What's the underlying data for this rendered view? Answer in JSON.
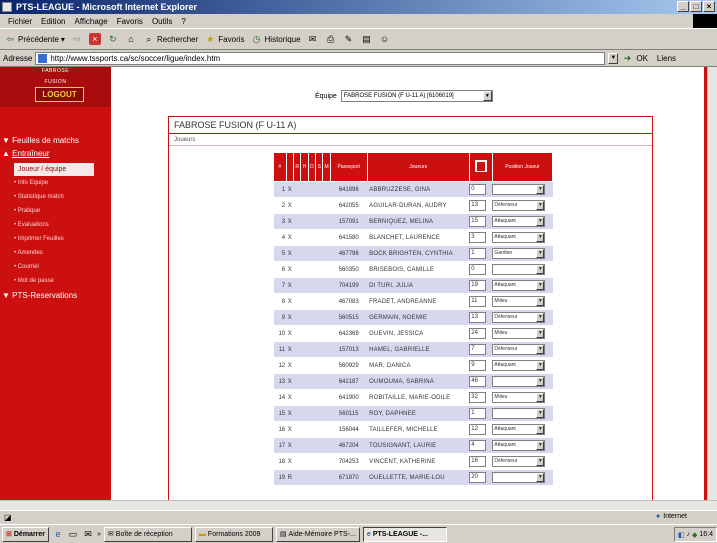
{
  "window": {
    "title": "PTS-LEAGUE - Microsoft Internet Explorer",
    "controls": [
      "_",
      "□",
      "×"
    ]
  },
  "menu": [
    "Fichier",
    "Edition",
    "Affichage",
    "Favoris",
    "Outils",
    "?"
  ],
  "toolbar": {
    "back_label": "Précédente",
    "search_label": "Rechercher",
    "favorites_label": "Favoris",
    "history_label": "Historique"
  },
  "address": {
    "label": "Adresse",
    "url": "http://www.tssports.ca/sc/soccer/ligue/index.htm",
    "go_label": "OK",
    "links_label": "Liens"
  },
  "sidebar": {
    "org_line1": "FABROSE",
    "org_line2": "FUSION",
    "logout_label": "LOGOUT",
    "feuilles": "Feuilles de matchs",
    "entraineur": "Entraîneur",
    "active_item": "Joueur / équipe",
    "sub_items": [
      "Info Equipe",
      "Statistique match",
      "Pratique",
      "Evaluations",
      "Imprimer Feuilles",
      "Amendes",
      "Courriel",
      "Mot de passe"
    ],
    "reservations": "PTS-Reservations"
  },
  "main": {
    "equipe_label": "Équipe",
    "equipe_value": "FABROSE FUSION (F U-11 A) [6106019]",
    "panel_title": "FABROSE FUSION (F U-11 A)",
    "panel_sub": "Joueurs"
  },
  "roster": {
    "headers": {
      "num": "#",
      "r": "R",
      "h": "H",
      "d": "D",
      "s": "S",
      "m": "M",
      "passport": "Passeport",
      "players": "Joueurs",
      "position": "Position Joueur"
    },
    "rows": [
      {
        "num": "1",
        "x": "X",
        "passport": "641898",
        "name": "ABBRUZZESE, GINA",
        "jersey": "0",
        "position": ""
      },
      {
        "num": "2",
        "x": "X",
        "passport": "642055",
        "name": "AGUILAR-DURAN, AUDRY",
        "jersey": "13",
        "position": "Défenseur"
      },
      {
        "num": "3",
        "x": "X",
        "passport": "157091",
        "name": "BERNIQUEZ, MELINA",
        "jersey": "15",
        "position": "Attaquant"
      },
      {
        "num": "4",
        "x": "X",
        "passport": "641580",
        "name": "BLANCHET, LAURENCE",
        "jersey": "3",
        "position": "Attaquant"
      },
      {
        "num": "5",
        "x": "X",
        "passport": "467798",
        "name": "BOCK BRIGHTEN, CYNTHIA",
        "jersey": "1",
        "position": "Gardien"
      },
      {
        "num": "6",
        "x": "X",
        "passport": "560350",
        "name": "BRISEBOIS, CAMILLE",
        "jersey": "0",
        "position": ""
      },
      {
        "num": "7",
        "x": "X",
        "passport": "704199",
        "name": "DI TURI, JULIA",
        "jersey": "19",
        "position": "Attaquant"
      },
      {
        "num": "8",
        "x": "X",
        "passport": "467083",
        "name": "FRADET, ANDREANNE",
        "jersey": "11",
        "position": "Milieu"
      },
      {
        "num": "9",
        "x": "X",
        "passport": "560515",
        "name": "GERMAIN, NOEMIE",
        "jersey": "13",
        "position": "Défenseur"
      },
      {
        "num": "10",
        "x": "X",
        "passport": "642369",
        "name": "GUEVIN, JESSICA",
        "jersey": "24",
        "position": "Milieu"
      },
      {
        "num": "11",
        "x": "X",
        "passport": "157013",
        "name": "HAMEL, GABRIELLE",
        "jersey": "7",
        "position": "Défenseur"
      },
      {
        "num": "12",
        "x": "X",
        "passport": "560929",
        "name": "MAR, DANICA",
        "jersey": "9",
        "position": "Attaquant"
      },
      {
        "num": "13",
        "x": "X",
        "passport": "642187",
        "name": "OUMOUMA, SABRINA",
        "jersey": "46",
        "position": ""
      },
      {
        "num": "14",
        "x": "X",
        "passport": "641900",
        "name": "ROBITAILLE, MARIE-ODILE",
        "jersey": "32",
        "position": "Milieu"
      },
      {
        "num": "15",
        "x": "X",
        "passport": "560115",
        "name": "ROY, DAPHNEE",
        "jersey": "1",
        "position": ""
      },
      {
        "num": "16",
        "x": "X",
        "passport": "156044",
        "name": "TAILLEFER, MICHELLE",
        "jersey": "12",
        "position": "Attaquant"
      },
      {
        "num": "17",
        "x": "X",
        "passport": "467204",
        "name": "TOUSIGNANT, LAURIE",
        "jersey": "4",
        "position": "Attaquant"
      },
      {
        "num": "18",
        "x": "X",
        "passport": "704253",
        "name": "VINCENT, KATHERINE",
        "jersey": "16",
        "position": "Défenseur"
      },
      {
        "num": "19",
        "x": "R",
        "passport": "671870",
        "name": "OUELLETTE, MARIE-LOU",
        "jersey": "20",
        "position": ""
      }
    ]
  },
  "status": {
    "zone_label": "Internet"
  },
  "taskbar": {
    "start_label": "Démarrer",
    "items": [
      "Boîte de réception",
      "Formations 2009",
      "Aide-Mémoire PTS-...",
      "PTS-LEAGUE -..."
    ],
    "clock": "16:4"
  },
  "colors": {
    "accent": "#cc1010",
    "row_alt": "#d6d9ee",
    "logout_text": "#f6c84a"
  }
}
